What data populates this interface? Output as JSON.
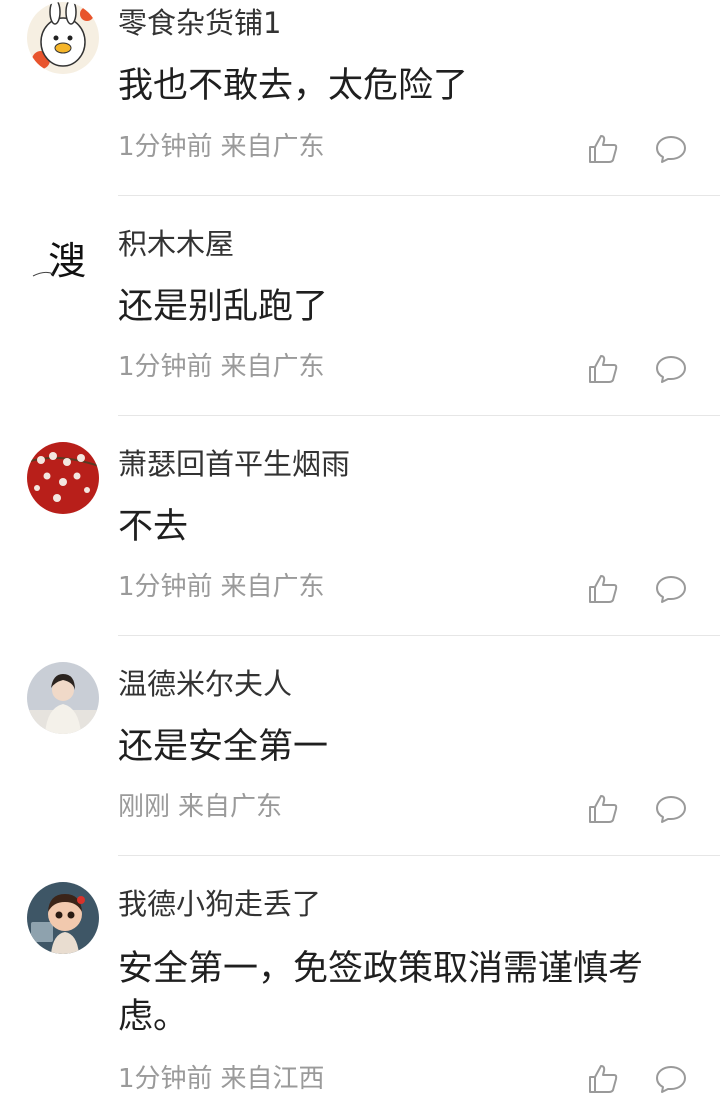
{
  "comments": [
    {
      "username": "零食杂货铺1",
      "text": "我也不敢去，太危险了",
      "time": "1分钟前",
      "location": "来自广东",
      "avatar": "cartoon-duck-avatar"
    },
    {
      "username": "积木木屋",
      "text": "还是别乱跑了",
      "time": "1分钟前",
      "location": "来自广东",
      "avatar": "calligraphy-avatar",
      "avatar_char": "溲"
    },
    {
      "username": "萧瑟回首平生烟雨",
      "text": "不去",
      "time": "1分钟前",
      "location": "来自广东",
      "avatar": "flowers-avatar"
    },
    {
      "username": "温德米尔夫人",
      "text": "还是安全第一",
      "time": "刚刚",
      "location": "来自广东",
      "avatar": "woman-portrait-avatar"
    },
    {
      "username": "我德小狗走丢了",
      "text": "安全第一，免签政策取消需谨慎考虑。",
      "time": "1分钟前",
      "location": "来自江西",
      "avatar": "cartoon-baby-avatar"
    }
  ],
  "icons": {
    "like": "thumbs-up-icon",
    "reply": "comment-bubble-icon"
  },
  "colors": {
    "meta": "#9a9a9a",
    "divider": "#e6e6e6",
    "text": "#1f1f1f"
  }
}
